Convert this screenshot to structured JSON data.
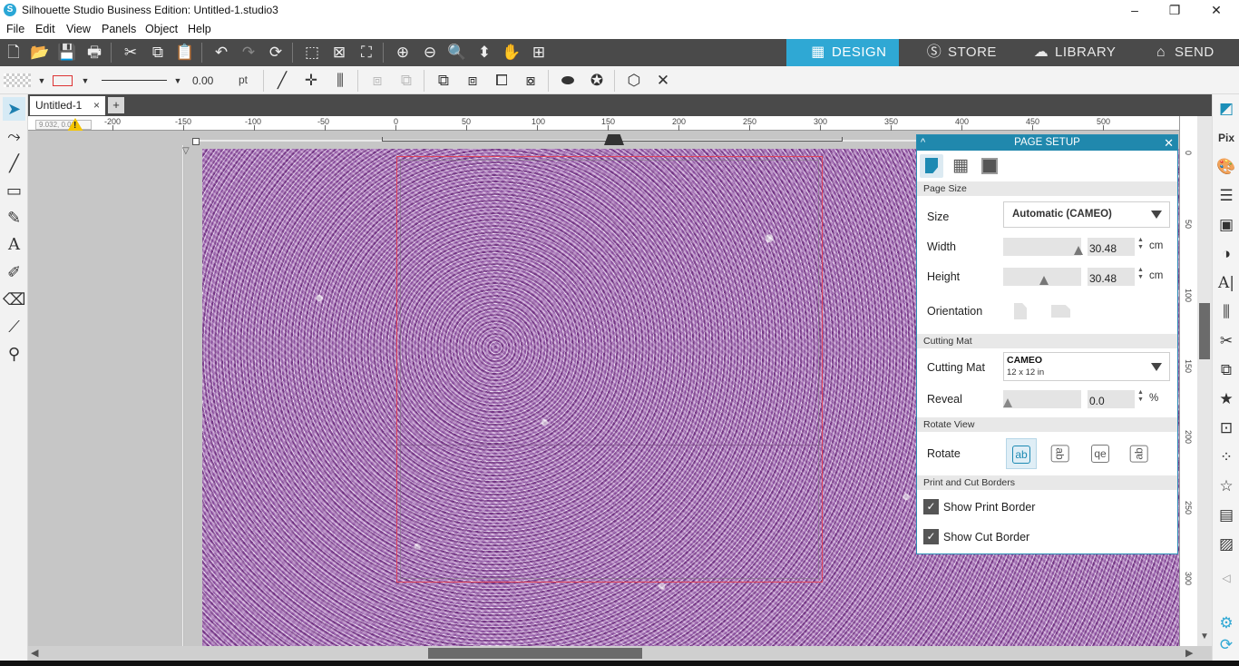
{
  "window": {
    "title": "Silhouette Studio Business Edition: Untitled-1.studio3",
    "logo": "S",
    "minimize": "–",
    "restore": "❐",
    "close": "✕"
  },
  "menu": [
    "File",
    "Edit",
    "View",
    "Panels",
    "Object",
    "Help"
  ],
  "modes": {
    "design": "DESIGN",
    "store": "STORE",
    "library": "LIBRARY",
    "send": "SEND"
  },
  "line_settings": {
    "weight": "0.00",
    "unit": "pt"
  },
  "document": {
    "tab_label": "Untitled-1",
    "tab_close": "×",
    "add_tab": "+"
  },
  "ruler": {
    "top_labels": [
      "-200",
      "-150",
      "-100",
      "-50",
      "0",
      "50",
      "100",
      "150",
      "200",
      "250",
      "300",
      "350",
      "400",
      "450",
      "500"
    ],
    "right_labels": [
      "0",
      "50",
      "100",
      "150",
      "200",
      "250",
      "300"
    ],
    "coord_readout": "9.032, 0.03",
    "warning_glyph": "!"
  },
  "page_setup": {
    "title": "PAGE SETUP",
    "collapse": "^",
    "close": "✕",
    "sections": {
      "page_size": "Page Size",
      "cutting_mat": "Cutting Mat",
      "rotate_view": "Rotate View",
      "borders": "Print and Cut Borders"
    },
    "size_label": "Size",
    "size_value": "Automatic (CAMEO)",
    "width_label": "Width",
    "width_value": "30.48",
    "width_unit": "cm",
    "height_label": "Height",
    "height_value": "30.48",
    "height_unit": "cm",
    "orientation_label": "Orientation",
    "mat_label": "Cutting Mat",
    "mat_value": "CAMEO",
    "mat_sub": "12 x 12 in",
    "reveal_label": "Reveal",
    "reveal_value": "0.0",
    "reveal_unit": "%",
    "rotate_label": "Rotate",
    "rotate_options": [
      "ab",
      "ab",
      "qe",
      "ab"
    ],
    "show_print_border": "Show Print Border",
    "show_cut_border": "Show Cut Border",
    "check_mark": "✓"
  },
  "colors": {
    "accent": "#2fa8d4",
    "panel_header": "#2088ad",
    "cut_border": "#e0435a",
    "toolbar_dark": "#4a4a4a"
  }
}
